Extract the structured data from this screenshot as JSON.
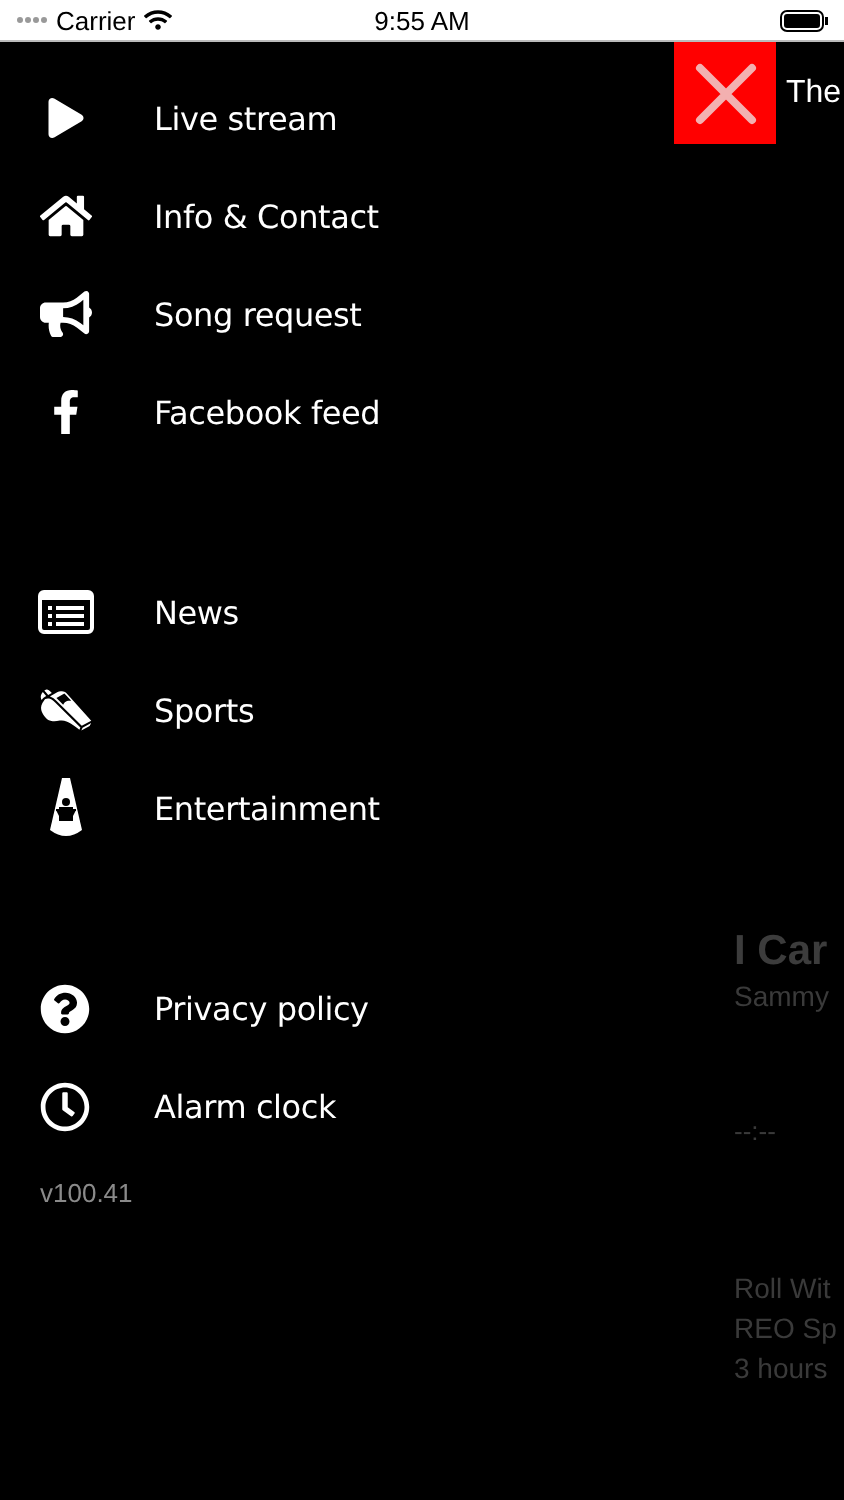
{
  "status_bar": {
    "carrier": "Carrier",
    "time": "9:55 AM"
  },
  "menu_groups": [
    {
      "items": [
        {
          "label": "Live stream",
          "kind": "play"
        },
        {
          "label": "Info & Contact",
          "kind": "home"
        },
        {
          "label": "Song request",
          "kind": "megaphone"
        },
        {
          "label": "Facebook feed",
          "kind": "facebook"
        }
      ]
    },
    {
      "items": [
        {
          "label": "News",
          "kind": "news"
        },
        {
          "label": "Sports",
          "kind": "whistle"
        },
        {
          "label": "Entertainment",
          "kind": "spotlight"
        }
      ]
    },
    {
      "items": [
        {
          "label": "Privacy policy",
          "kind": "help"
        },
        {
          "label": "Alarm clock",
          "kind": "clock"
        }
      ]
    }
  ],
  "version": "v100.41",
  "background_content": {
    "title_fragment": "The",
    "song_title": "I Car",
    "song_artist": "Sammy",
    "time": "--:--",
    "previous": [
      "Roll Wit",
      "REO Sp",
      "3 hours"
    ]
  }
}
